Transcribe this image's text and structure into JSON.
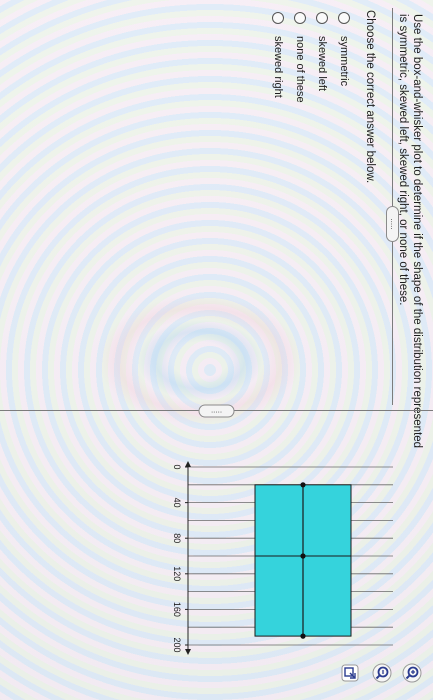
{
  "question": {
    "text": "Use the box-and-whisker plot to determine if the shape of the distribution represented is symmetric, skewed left, skewed right, or none of these.",
    "prompt": "Choose the correct answer below."
  },
  "options": [
    {
      "label": "symmetric",
      "selected": false
    },
    {
      "label": "skewed left",
      "selected": false
    },
    {
      "label": "none of these",
      "selected": false
    },
    {
      "label": "skewed right",
      "selected": false
    }
  ],
  "more_indicator": ".....",
  "chart_data": {
    "type": "box",
    "orientation": "horizontal",
    "x_ticks": [
      "0",
      "40",
      "80",
      "120",
      "160",
      "200"
    ],
    "xlim": [
      0,
      200
    ],
    "minimum": 20,
    "q1": 20,
    "median": 100,
    "q3": 190,
    "maximum": 190,
    "grid": true,
    "box_color": "#35d3dc"
  },
  "tools": [
    {
      "icon": "zoom-in-icon"
    },
    {
      "icon": "zoom-out-icon"
    },
    {
      "icon": "popout-icon"
    }
  ]
}
